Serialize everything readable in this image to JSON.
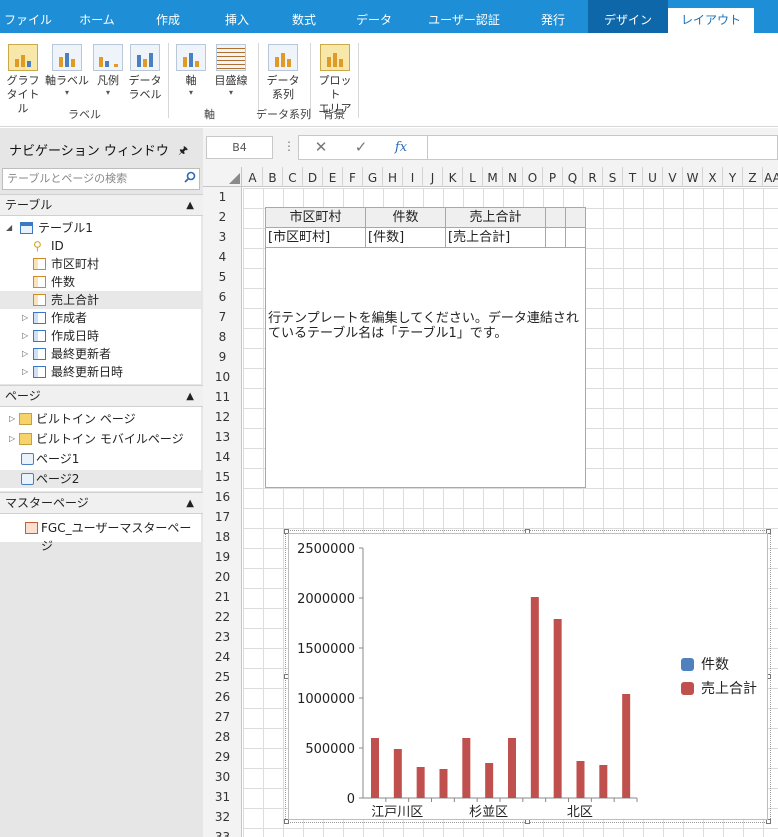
{
  "ribbon_tabs": [
    "ファイル",
    "ホーム",
    "作成",
    "挿入",
    "数式",
    "データ",
    "ユーザー認証",
    "発行",
    "デザイン",
    "レイアウト"
  ],
  "active_tab": "レイアウト",
  "ribbon": {
    "buttons": [
      {
        "line1": "グラフ",
        "line2": "タイトル",
        "dropdown": ""
      },
      {
        "line1": "軸ラベル",
        "line2": "",
        "dropdown": "▾"
      },
      {
        "line1": "凡例",
        "line2": "",
        "dropdown": "▾"
      },
      {
        "line1": "データ",
        "line2": "ラベル",
        "dropdown": ""
      },
      {
        "line1": "軸",
        "line2": "",
        "dropdown": "▾"
      },
      {
        "line1": "目盛線",
        "line2": "",
        "dropdown": "▾"
      },
      {
        "line1": "データ",
        "line2": "系列",
        "dropdown": ""
      },
      {
        "line1": "プロット",
        "line2": "エリア",
        "dropdown": ""
      }
    ],
    "groups": [
      "ラベル",
      "軸",
      "データ系列",
      "背景"
    ]
  },
  "nav": {
    "title": "ナビゲーション ウィンドウ",
    "search_placeholder": "テーブルとページの検索",
    "table_section": "テーブル",
    "table_name": "テーブル1",
    "fields": [
      "ID",
      "市区町村",
      "件数",
      "売上合計",
      "作成者",
      "作成日時",
      "最終更新者",
      "最終更新日時"
    ],
    "page_section": "ページ",
    "pages": [
      "ビルトイン ページ",
      "ビルトイン モバイルページ",
      "ページ1",
      "ページ2"
    ],
    "master_section": "マスターページ",
    "master_pages": [
      "FGC_ユーザーマスターページ"
    ]
  },
  "formula_bar": {
    "cell_ref": "B4",
    "formula": ""
  },
  "sheet": {
    "columns": [
      "A",
      "B",
      "C",
      "D",
      "E",
      "F",
      "G",
      "H",
      "I",
      "J",
      "K",
      "L",
      "M",
      "N",
      "O",
      "P",
      "Q",
      "R",
      "S",
      "T",
      "U",
      "V",
      "W",
      "X",
      "Y",
      "Z",
      "AA"
    ],
    "rows": [
      "1",
      "2",
      "3",
      "4",
      "5",
      "6",
      "7",
      "8",
      "9",
      "10",
      "11",
      "12",
      "13",
      "14",
      "15",
      "16",
      "17",
      "18",
      "19",
      "20",
      "21",
      "22",
      "23",
      "24",
      "25",
      "26",
      "27",
      "28",
      "29",
      "30",
      "31",
      "32",
      "33"
    ],
    "header_cells": [
      "市区町村",
      "件数",
      "売上合計"
    ],
    "data_cells": [
      "[市区町村]",
      "[件数]",
      "[売上合計]"
    ],
    "template_message": "行テンプレートを編集してください。データ連結されているテーブル名は「テーブル1」です。"
  },
  "chart_data": {
    "type": "bar",
    "title": "",
    "xlabel": "",
    "ylabel": "",
    "ylim": [
      0,
      2500000
    ],
    "yticks": [
      "2500000",
      "2000000",
      "1500000",
      "1000000",
      "500000",
      "0"
    ],
    "x_tick_labels": [
      "江戸川区",
      "杉並区",
      "北区"
    ],
    "categories": [
      "",
      "",
      "",
      "",
      "",
      "",
      "",
      "",
      "",
      "",
      "",
      ""
    ],
    "series": [
      {
        "name": "件数",
        "color": "#4f81bd",
        "values": [
          0,
          0,
          0,
          0,
          0,
          0,
          0,
          0,
          0,
          0,
          0,
          0
        ]
      },
      {
        "name": "売上合計",
        "color": "#c0504d",
        "values": [
          600000,
          490000,
          310000,
          290000,
          600000,
          350000,
          600000,
          2010000,
          1790000,
          370000,
          330000,
          1040000
        ]
      }
    ],
    "legend": "right",
    "grid": false
  }
}
